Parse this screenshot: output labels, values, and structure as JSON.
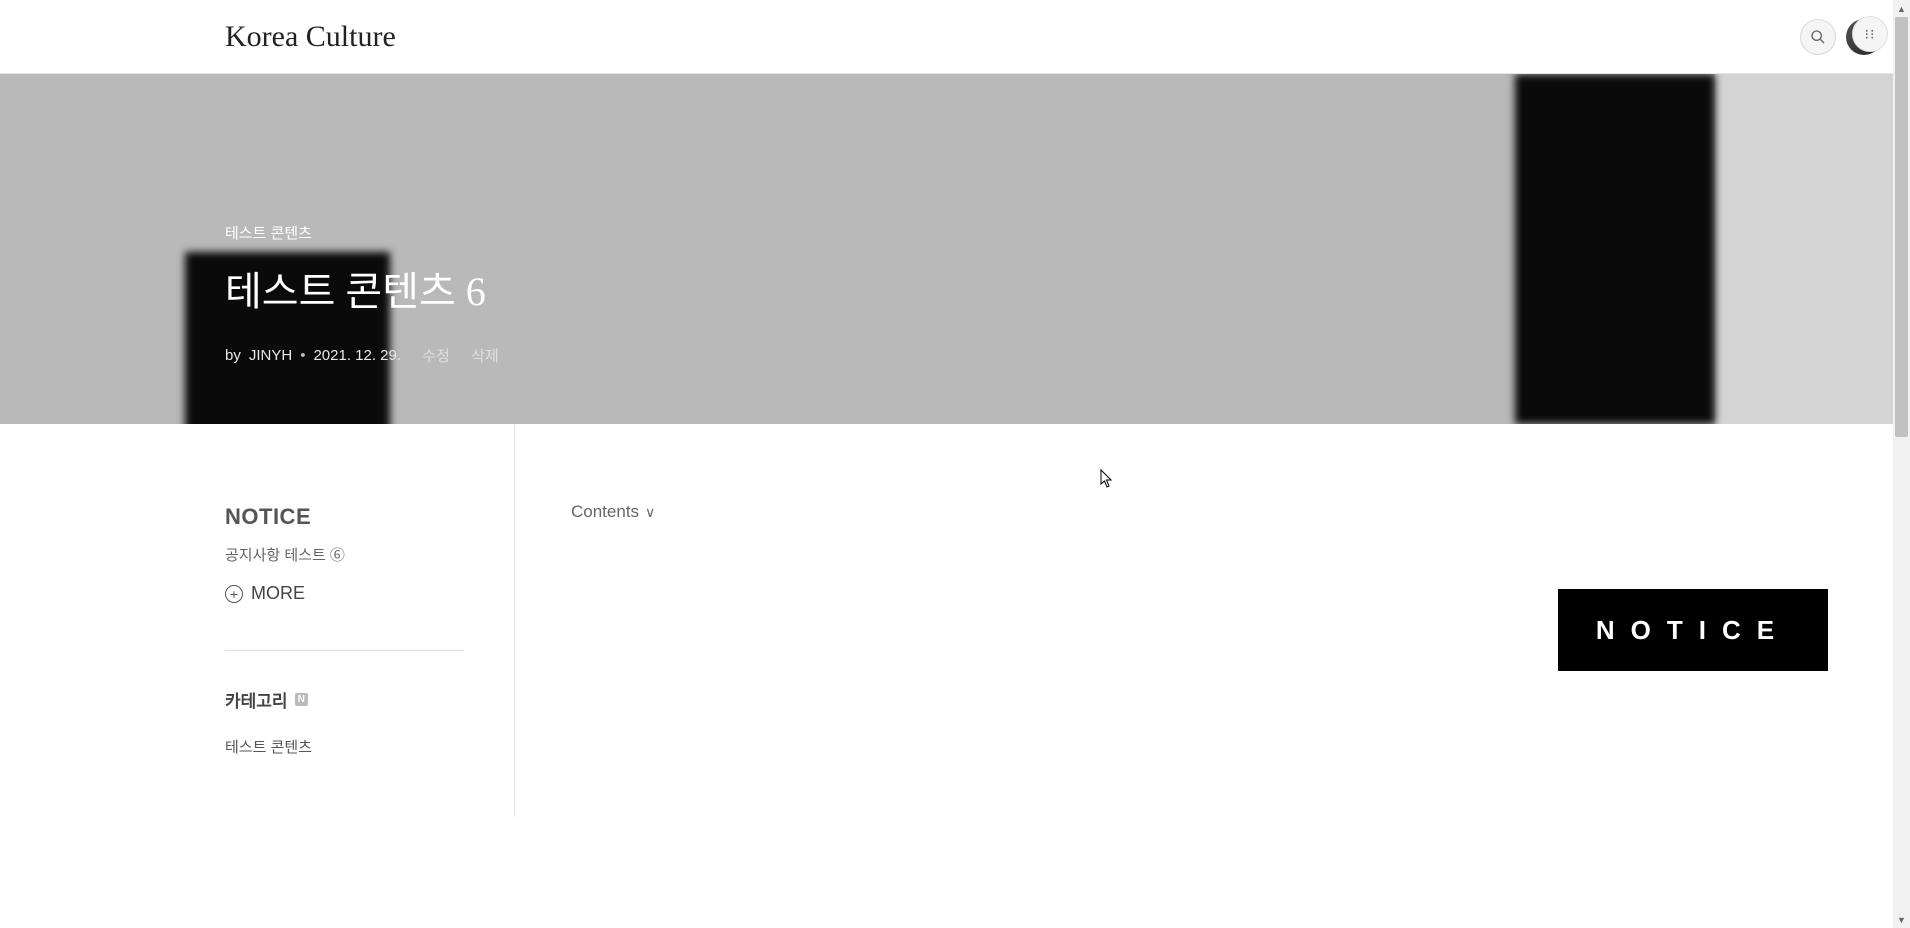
{
  "header": {
    "site_title": "Korea Culture"
  },
  "hero": {
    "category": "테스트 콘텐츠",
    "title": "테스트 콘텐츠 6",
    "by_prefix": "by",
    "author": "JINYH",
    "date": "2021. 12. 29.",
    "edit": "수정",
    "delete": "삭제"
  },
  "sidebar": {
    "notice_title": "NOTICE",
    "notice_item": "공지사항 테스트 ⑥",
    "more_label": "MORE",
    "category_title": "카테고리",
    "category_badge": "N",
    "categories": [
      "테스트 콘텐츠"
    ]
  },
  "content": {
    "contents_label": "Contents",
    "notice_block": "NOTICE"
  }
}
